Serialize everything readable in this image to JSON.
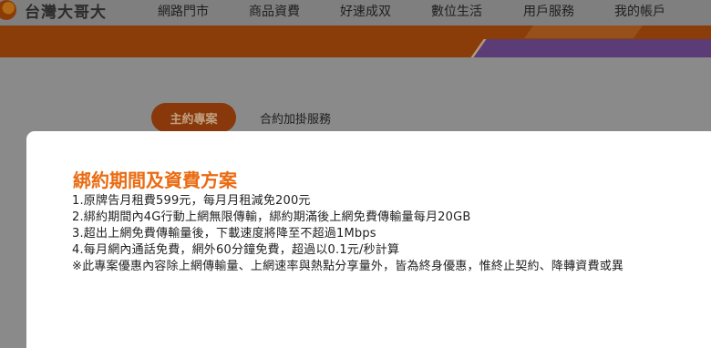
{
  "brand": {
    "name": "台灣大哥大",
    "logo_icon": "brand-orb-icon"
  },
  "nav": {
    "items": [
      {
        "label": "網路門市"
      },
      {
        "label": "商品資費"
      },
      {
        "label": "好速成双"
      },
      {
        "label": "數位生活"
      },
      {
        "label": "用戶服務"
      },
      {
        "label": "我的帳戶"
      }
    ]
  },
  "tabs": [
    {
      "label": "主約專案",
      "active": true
    },
    {
      "label": "合約加掛服務",
      "active": false
    }
  ],
  "modal": {
    "title": "綁約期間及資費方案",
    "terms": [
      "1.原牌告月租費599元，每月月租減免200元",
      "2.綁約期間內4G行動上網無限傳輸，綁約期滿後上網免費傳輸量每月20GB",
      "3.超出上網免費傳輸量後，下載速度將降至不超過1Mbps",
      "4.每月網內通話免費，網外60分鐘免費，超過以0.1元/秒計算",
      "※此專案優惠內容除上網傳輸量、上網速率與熱點分享量外，皆為終身優惠，惟終止契約、降轉資費或異"
    ]
  },
  "colors": {
    "overlay_header": "#7f7f7f",
    "overlay_banner": "#8a3d08",
    "overlay_page": "#8a8a8a",
    "accent_orange": "#ea6b12",
    "modal_bg": "#ffffff"
  }
}
